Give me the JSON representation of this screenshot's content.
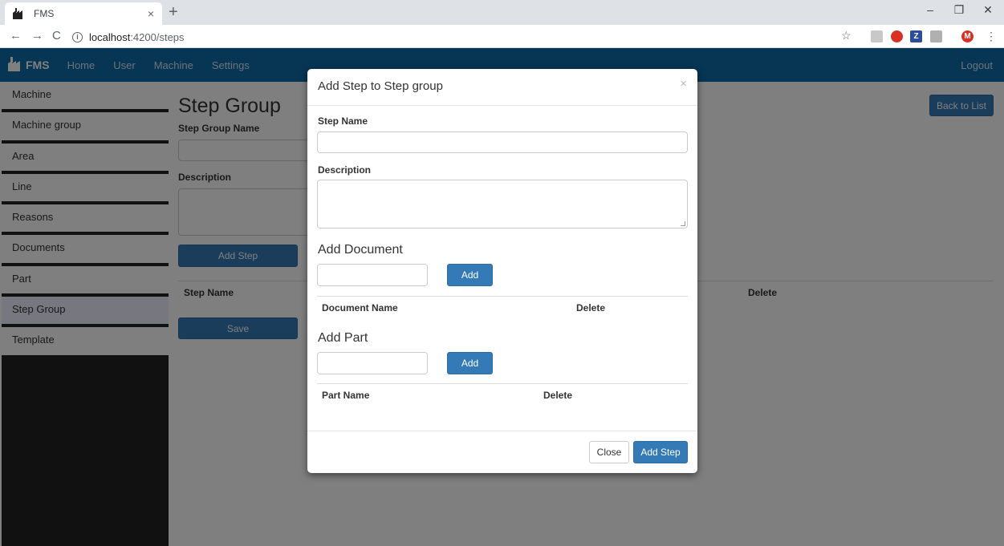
{
  "browser": {
    "tab_title": "FMS",
    "tab_close": "×",
    "new_tab": "+",
    "url_host": "localhost",
    "url_path": ":4200/steps",
    "minimize": "–",
    "restore": "❐",
    "close": "✕",
    "profile_initial": "M"
  },
  "appbar": {
    "brand": "FMS",
    "nav": [
      "Home",
      "User",
      "Machine",
      "Settings"
    ],
    "logout": "Logout"
  },
  "sidebar": {
    "items": [
      "Machine",
      "Machine group",
      "Area",
      "Line",
      "Reasons",
      "Documents",
      "Part",
      "Step Group",
      "Template"
    ],
    "active_index": 7
  },
  "main": {
    "title": "Step Group",
    "step_group_name_label": "Step Group Name",
    "description_label": "Description",
    "add_step_button": "Add Step",
    "back_button": "Back to List",
    "table_step_name": "Step Name",
    "table_delete": "Delete",
    "save_button": "Save"
  },
  "modal": {
    "title": "Add Step to Step group",
    "close_x": "×",
    "step_name_label": "Step Name",
    "description_label": "Description",
    "add_document_heading": "Add Document",
    "add_document_button": "Add",
    "document_name_header": "Document Name",
    "document_delete_header": "Delete",
    "add_part_heading": "Add Part",
    "add_part_button": "Add",
    "part_name_header": "Part Name",
    "part_delete_header": "Delete",
    "close_button": "Close",
    "add_step_button": "Add Step"
  },
  "colors": {
    "appbar": "#0e6ba8",
    "primary": "#337ab7"
  }
}
